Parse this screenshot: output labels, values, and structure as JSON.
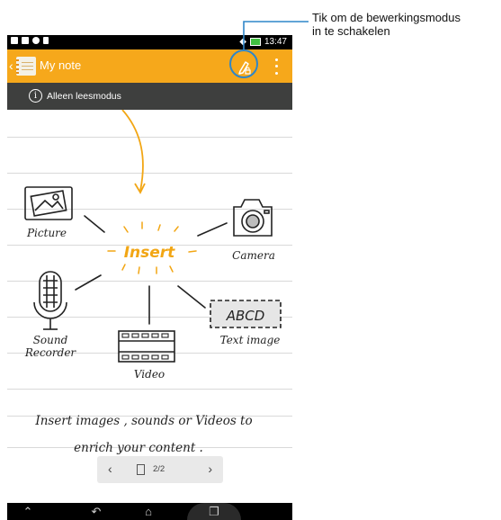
{
  "callout": {
    "line1": "Tik om de bewerkingsmodus",
    "line2": "in te schakelen"
  },
  "status_bar": {
    "time": "13:47",
    "icons": [
      "tv-icon",
      "mail-icon",
      "location-icon",
      "lock-icon"
    ]
  },
  "action_bar": {
    "title": "My note",
    "edit_icon": "edit-mode-icon",
    "menu_icon": "overflow-menu-icon"
  },
  "readonly_bar": {
    "label": "Alleen leesmodus",
    "icon": "info-icon"
  },
  "illustration": {
    "center_label": "Insert",
    "items": {
      "picture": "Picture",
      "camera": "Camera",
      "sound_line1": "Sound",
      "sound_line2": "Recorder",
      "video": "Video",
      "text_image": "Text image",
      "abcd": "ABCD"
    },
    "caption_line1": "Insert images , sounds or Videos to",
    "caption_line2": "enrich your content ."
  },
  "pager": {
    "label": "2/2",
    "prev_icon": "chevron-left-icon",
    "next_icon": "chevron-right-icon"
  },
  "nav_bar": {
    "buttons": [
      "menu-icon",
      "back-icon",
      "home-icon",
      "recents-icon"
    ]
  },
  "colors": {
    "accent": "#f6a81b",
    "readonly_bar": "#3e3f3e",
    "callout_line": "#2f86c8",
    "insert_color": "#f2a614"
  }
}
